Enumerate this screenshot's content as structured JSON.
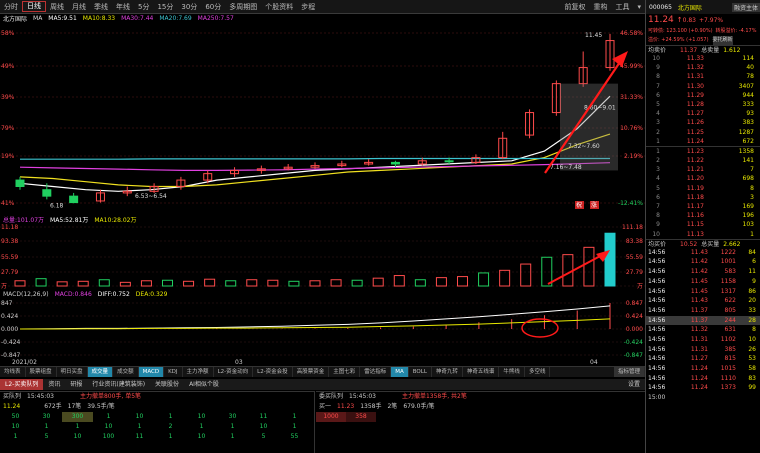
{
  "toolbar": {
    "items": [
      "分时",
      "日线",
      "周线",
      "月线",
      "季线",
      "年线",
      "5分",
      "15分",
      "30分",
      "60分",
      "多周期图",
      "个股资料",
      "步程"
    ],
    "active": 1,
    "right": [
      "前复权",
      "重构",
      "工具",
      "▾"
    ]
  },
  "ma_bar": {
    "name": "北方国际",
    "items": [
      "MA",
      "MA5:9.51",
      "MA10:8.33",
      "MA30:7.44",
      "MA20:7.69",
      "MA250:7.57"
    ]
  },
  "main_chart": {
    "left_labels": [
      "58%",
      "49%",
      "39%",
      "79%",
      "19%",
      "41%"
    ],
    "right_labels": [
      "46.58%",
      "45.99%",
      "31.33%",
      "10.76%",
      "2.19%",
      "-12.41%"
    ],
    "annotations": {
      "high": "11.45",
      "mid1": "8.60~9.01",
      "mid2": "7.32~7.60",
      "low1": "6.53~6.54",
      "low2": "6.18",
      "low3": "7.16~7.48"
    },
    "markers": [
      "祝",
      "涨"
    ]
  },
  "chart_data": [
    {
      "type": "candlestick",
      "title": "日线",
      "series": [
        {
          "name": "MA5",
          "values": [
            6.8,
            6.7,
            6.6,
            6.55,
            6.6,
            6.7,
            6.9,
            7.0,
            7.1,
            7.2,
            7.25,
            7.3,
            7.35,
            7.4,
            7.45,
            7.5,
            7.8,
            8.5,
            9.51
          ]
        },
        {
          "name": "MA10",
          "values": [
            7.0,
            6.95,
            6.85,
            6.75,
            6.7,
            6.7,
            6.75,
            6.85,
            6.95,
            7.05,
            7.15,
            7.2,
            7.25,
            7.3,
            7.35,
            7.4,
            7.6,
            8.0,
            8.33
          ]
        },
        {
          "name": "MA30",
          "values": [
            7.3,
            7.28,
            7.26,
            7.24,
            7.22,
            7.2,
            7.2,
            7.21,
            7.22,
            7.24,
            7.26,
            7.28,
            7.3,
            7.32,
            7.34,
            7.36,
            7.38,
            7.41,
            7.44
          ]
        },
        {
          "name": "MA250",
          "values": [
            7.55,
            7.55,
            7.55,
            7.55,
            7.56,
            7.56,
            7.56,
            7.56,
            7.56,
            7.56,
            7.56,
            7.57,
            7.57,
            7.57,
            7.57,
            7.57,
            7.57,
            7.57,
            7.57
          ]
        }
      ],
      "ylim": [
        6.0,
        11.6
      ]
    },
    {
      "type": "bar",
      "title": "总量",
      "series": [
        {
          "name": "总量:101.07万",
          "values": [
            10,
            14,
            8,
            9,
            12,
            7,
            10,
            11,
            9,
            13,
            10,
            12,
            11,
            9,
            10,
            12,
            11,
            15,
            20,
            12,
            16,
            18,
            25,
            30,
            42,
            55,
            60,
            74,
            101
          ]
        }
      ]
    },
    {
      "type": "line",
      "title": "MACD(12,26,9)",
      "series": [
        {
          "name": "MACD",
          "values": [
            0.0,
            0.0,
            0.01,
            0.0,
            0.01,
            0.0,
            0.01,
            0.0,
            0.01,
            0.02,
            0.03,
            0.05,
            0.08,
            0.14,
            0.22,
            0.32,
            0.45,
            0.6,
            0.846
          ]
        },
        {
          "name": "DIFF",
          "values": [
            0.0,
            0.01,
            0.02,
            0.02,
            0.03,
            0.04,
            0.05,
            0.07,
            0.09,
            0.12,
            0.15,
            0.2,
            0.26,
            0.33,
            0.4,
            0.48,
            0.56,
            0.65,
            0.752
          ]
        },
        {
          "name": "DEA",
          "values": [
            0.0,
            0.0,
            0.01,
            0.01,
            0.02,
            0.02,
            0.03,
            0.03,
            0.04,
            0.05,
            0.06,
            0.08,
            0.1,
            0.13,
            0.16,
            0.2,
            0.24,
            0.28,
            0.329
          ]
        }
      ]
    }
  ],
  "vol_bar": {
    "items": [
      "总量:101.07万",
      "MA5:52.81万",
      "MA10:28.02万"
    ],
    "left_labels": [
      "11.18",
      "93.38",
      "55.59",
      "27.79",
      "万"
    ],
    "right_labels": [
      "111.18",
      "83.38",
      "55.59",
      "27.79",
      "万"
    ]
  },
  "macd_bar": {
    "items": [
      "MACD(12,26,9)",
      "MACD:0.846",
      "DIFF:0.752",
      "DEA:0.329"
    ],
    "left_labels": [
      "847",
      "0.424",
      "0.000",
      "-0.424",
      "-0.847"
    ],
    "right_labels": [
      "0.847",
      "0.424",
      "0.000",
      "-0.424",
      "-0.847"
    ]
  },
  "dates": {
    "d1": "2021/02",
    "d2": "03",
    "d3": "04"
  },
  "tabs": [
    "均线表",
    "股票组盘",
    "明日买盘",
    "成交量",
    "成交额",
    "MACD",
    "KDJ",
    "主力净额",
    "L2-资金动向",
    "L2-资金会投",
    "高股票资金",
    "主图七彩",
    "雷达指标",
    "MA",
    "BOLL",
    "神奇九转",
    "神奇五线谱",
    "牛熊线",
    "多空线",
    "指标管理"
  ],
  "tabs2": {
    "items": [
      "L2-买卖队列",
      "资讯",
      "研报",
      "行业资讯(建筑装饰)",
      "关联股份",
      "AI相似个股"
    ],
    "right": "设置"
  },
  "buy_queue": {
    "title": "买队列",
    "time": "15:45:03",
    "note": "主力撤单800手, 单5笔",
    "price": "11.24",
    "vol": "672手",
    "count": "17笔",
    "avg": "39.5手/笔",
    "cells": [
      "50",
      "30",
      "300",
      "1",
      "10",
      "1",
      "10",
      "30",
      "11",
      "1",
      "10",
      "1",
      "1",
      "10",
      "1",
      "2",
      "1",
      "1",
      "10",
      "1",
      "1",
      "5",
      "10",
      "100",
      "11",
      "1",
      "10",
      "1",
      "5",
      "55"
    ]
  },
  "sell_queue": {
    "title": "委买队列",
    "time": "15:45:03",
    "note": "主力撤单1358手, 共2笔",
    "label": "买一",
    "price": "11.23",
    "vol": "1358手",
    "count": "2笔",
    "avg": "679.0手/笔",
    "cells": [
      "1000",
      "358"
    ]
  },
  "stock": {
    "code": "000065",
    "name": "北方国际",
    "btn": "融资主体",
    "price": "11.24",
    "arrow": "↑",
    "change": "0.83",
    "pct": "+7.97%",
    "l1": "可转债: 123.100 (+0.90%)",
    "l2": "转股溢价: -4.17%",
    "l3": "溢价: +24.59% (+1.057)",
    "l4": "委托刷新",
    "avg_label": "均卖价",
    "avg": "11.37",
    "total_label": "总卖量",
    "total": "1.612"
  },
  "asks": [
    [
      "10",
      "11.33",
      "114"
    ],
    [
      "9",
      "11.32",
      "40"
    ],
    [
      "8",
      "11.31",
      "78"
    ],
    [
      "7",
      "11.30",
      "3407"
    ],
    [
      "6",
      "11.29",
      "944"
    ],
    [
      "5",
      "11.28",
      "333"
    ],
    [
      "4",
      "11.27",
      "93"
    ],
    [
      "3",
      "11.26",
      "383"
    ],
    [
      "2",
      "11.25",
      "1287"
    ],
    [
      "1",
      "11.24",
      "672"
    ]
  ],
  "bids": [
    [
      "1",
      "11.23",
      "1358"
    ],
    [
      "2",
      "11.22",
      "141"
    ],
    [
      "3",
      "11.21",
      "7"
    ],
    [
      "4",
      "11.20",
      "698"
    ],
    [
      "5",
      "11.19",
      "8"
    ],
    [
      "6",
      "11.18",
      "3"
    ],
    [
      "7",
      "11.17",
      "169"
    ],
    [
      "8",
      "11.16",
      "196"
    ],
    [
      "9",
      "11.15",
      "103"
    ],
    [
      "10",
      "11.13",
      "1"
    ]
  ],
  "bid_side": {
    "avg_label": "均买价",
    "avg": "10.52",
    "total_label": "总买量",
    "total": "2.662"
  },
  "ticks": [
    [
      "14:56",
      "11.43",
      "1222",
      "84"
    ],
    [
      "14:56",
      "11.42",
      "1001",
      "6"
    ],
    [
      "14:56",
      "11.42",
      "583",
      "11"
    ],
    [
      "14:56",
      "11.45",
      "1158",
      "9"
    ],
    [
      "14:56",
      "11.45",
      "1317",
      "86"
    ],
    [
      "14:56",
      "11.43",
      "622",
      "20"
    ],
    [
      "14:56",
      "11.37",
      "805",
      "33"
    ],
    [
      "14:56",
      "11.37",
      "244",
      "28"
    ],
    [
      "14:56",
      "11.32",
      "631",
      "8"
    ],
    [
      "14:56",
      "11.31",
      "1102",
      "10"
    ],
    [
      "14:56",
      "11.31",
      "385",
      "26"
    ],
    [
      "14:56",
      "11.27",
      "815",
      "53"
    ],
    [
      "14:56",
      "11.24",
      "1015",
      "58"
    ],
    [
      "14:56",
      "11.24",
      "1110",
      "83"
    ],
    [
      "14:56",
      "11.24",
      "1373",
      "99"
    ]
  ],
  "tick_end": "15:00",
  "colors": {
    "up": "#ff4b4b",
    "down": "#20d060",
    "arrow": "#ff1a1a",
    "ma5": "#ffffff",
    "ma10": "#f0e020",
    "ma30": "#e040e0",
    "ma250": "#3cc4d0"
  }
}
